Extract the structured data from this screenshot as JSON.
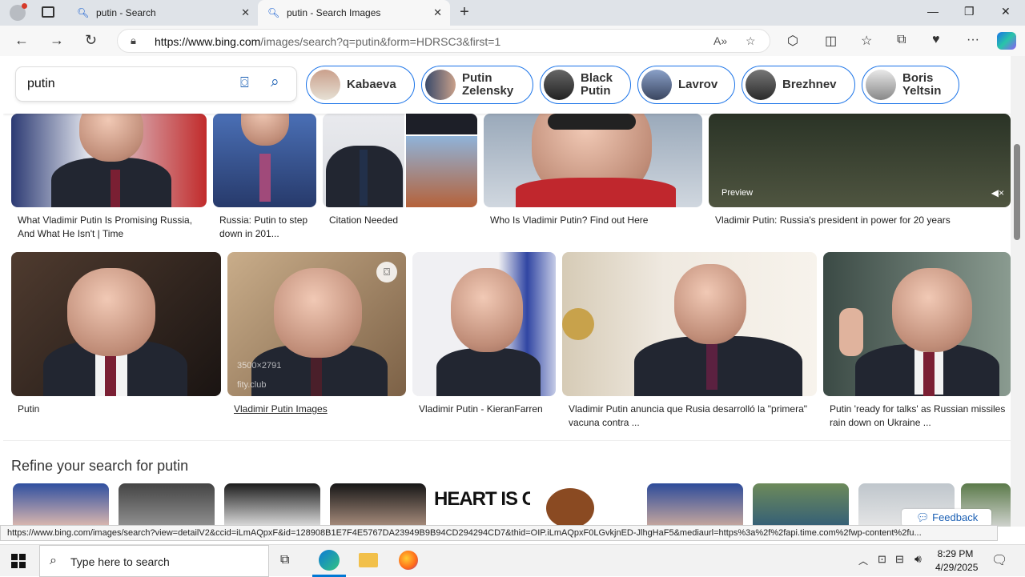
{
  "browser": {
    "tabs": [
      {
        "title": "putin - Search"
      },
      {
        "title": "putin - Search Images"
      }
    ],
    "url_host": "https://www.bing.com",
    "url_path": "/images/search?q=putin&form=HDRSC3&first=1"
  },
  "search": {
    "query": "putin"
  },
  "related_chips": [
    {
      "label": "Kabaeva"
    },
    {
      "label": "Putin Zelensky"
    },
    {
      "label": "Black Putin"
    },
    {
      "label": "Lavrov"
    },
    {
      "label": "Brezhnev"
    },
    {
      "label": "Boris Yeltsin"
    }
  ],
  "results_row1": [
    {
      "caption": "What Vladimir Putin Is Promising Russia, And What He Isn't | Time"
    },
    {
      "caption": "Russia: Putin to step down in 201..."
    },
    {
      "caption": "Citation Needed"
    },
    {
      "caption": "Who Is Vladimir Putin? Find out Here"
    },
    {
      "caption": "Vladimir Putin: Russia's president in power for 20 years",
      "badge": "Preview"
    }
  ],
  "results_row2": [
    {
      "caption": "Putin"
    },
    {
      "caption": "Vladimir Putin Images",
      "dimensions": "3500×2791",
      "source": "fity.club"
    },
    {
      "caption": "Vladimir Putin - KieranFarren"
    },
    {
      "caption": "Vladimir Putin anuncia que Rusia desarrolló la \"primera\" vacuna contra ..."
    },
    {
      "caption": "Putin 'ready for talks' as Russian missiles rain down on Ukraine ..."
    }
  ],
  "refine": {
    "title": "Refine your search for putin",
    "heart_text": "HEART IS CO"
  },
  "feedback_label": "Feedback",
  "status_url": "https://www.bing.com/images/search?view=detailV2&ccid=iLmAQpxF&id=128908B1E7F4E5767DA23949B9B94CD294294CD7&thid=OIP.iLmAQpxF0LGvkjnED-JlhgHaF5&mediaurl=https%3a%2f%2fapi.time.com%2fwp-content%2fu...",
  "taskbar": {
    "search_placeholder": "Type here to search",
    "time": "8:29 PM",
    "date": "4/29/2025"
  }
}
